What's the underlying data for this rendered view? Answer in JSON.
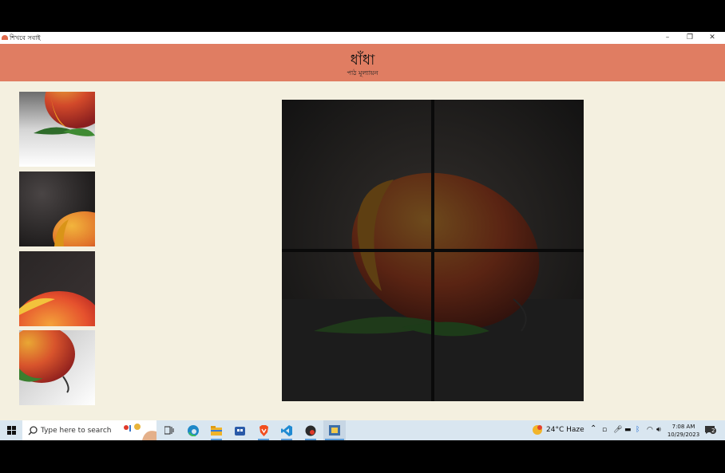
{
  "window": {
    "title": "শিখবে সবাই",
    "controls": {
      "minimize": "–",
      "restore": "❐",
      "close": "✕"
    }
  },
  "banner": {
    "title": "ধাঁধা",
    "subtitle": "পাঠ মূল্যায়ন",
    "color": "#e07d62"
  },
  "colors": {
    "background": "#f4f0e0",
    "board": "#000000"
  },
  "thumbnails": [
    {
      "name": "piece-1",
      "alt": "mango top-left piece"
    },
    {
      "name": "piece-2",
      "alt": "mango top-right piece"
    },
    {
      "name": "piece-3",
      "alt": "mango left piece"
    },
    {
      "name": "piece-4",
      "alt": "mango bottom piece"
    }
  ],
  "taskbar": {
    "search_placeholder": "Type here to search",
    "weather": "24°C  Haze",
    "time": "7:08 AM",
    "date": "10/29/2023",
    "notification_count": "2"
  }
}
